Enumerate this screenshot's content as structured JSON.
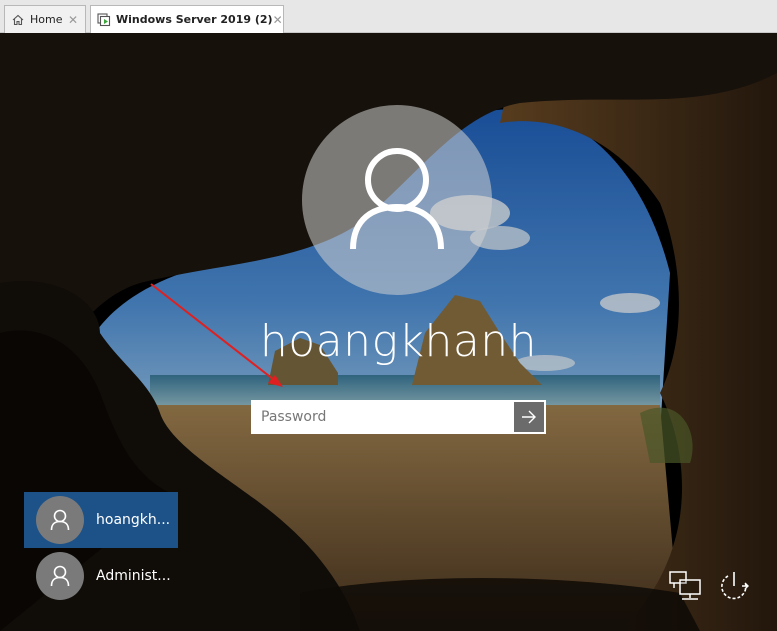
{
  "tabs": [
    {
      "label": "Home",
      "icon": "home-icon",
      "active": false
    },
    {
      "label": "Windows Server 2019 (2)",
      "icon": "vm-icon",
      "active": true
    }
  ],
  "lock_screen": {
    "username": "hoangkhanh",
    "password": {
      "placeholder": "Password",
      "value": ""
    },
    "submit_icon": "arrow-right-icon",
    "users": [
      {
        "label": "hoangkh...",
        "selected": true
      },
      {
        "label": "Administ...",
        "selected": false
      }
    ],
    "corner_icons": [
      "network-icon",
      "power-icon"
    ],
    "colors": {
      "selected_user": "#1d5288",
      "annotation_arrow": "#e02020"
    }
  }
}
